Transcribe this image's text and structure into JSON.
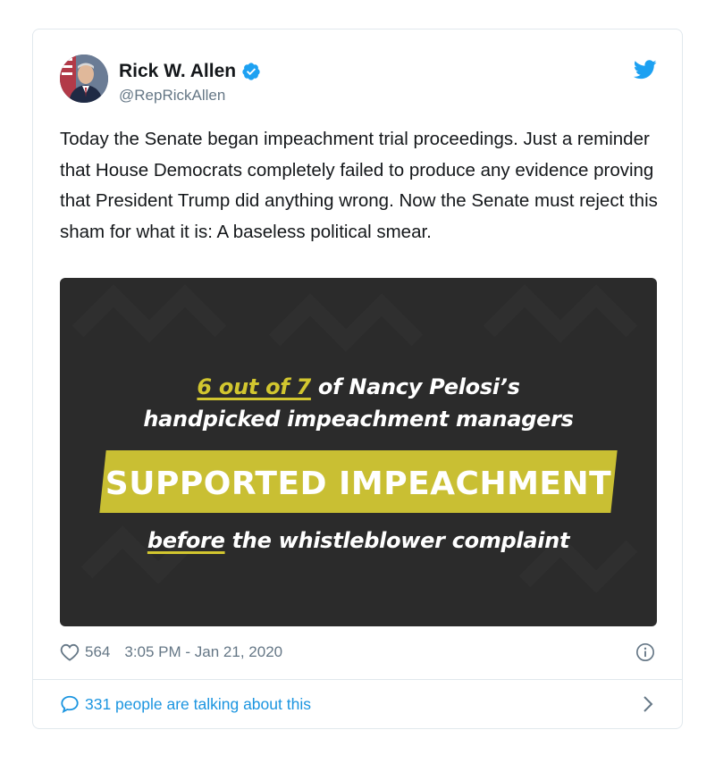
{
  "author": {
    "name": "Rick W. Allen",
    "handle": "@RepRickAllen",
    "verified": true
  },
  "tweet": {
    "text": "Today the Senate began impeachment trial proceedings. Just a reminder that House Democrats completely failed to produce any evidence proving that President Trump did anything wrong. Now the Senate must reject this sham for what it is: A baseless political smear."
  },
  "media": {
    "line1_highlight": "6 out of 7",
    "line1_rest": " of Nancy Pelosi’s",
    "line2": "handpicked impeachment managers",
    "banner": "SUPPORTED IMPEACHMENT",
    "line3_highlight": "before",
    "line3_rest": " the whistleblower complaint"
  },
  "meta": {
    "likes": "564",
    "timestamp": "3:05 PM - Jan 21, 2020"
  },
  "footer": {
    "talking": "331 people are talking about this"
  },
  "colors": {
    "link": "#1b95e0",
    "muted": "#657786",
    "media_bg": "#2b2b2b",
    "highlight": "#c9bf33"
  },
  "icons": [
    "verified-badge-icon",
    "twitter-bird-icon",
    "heart-icon",
    "info-icon",
    "comment-bubble-icon",
    "chevron-right-icon"
  ]
}
